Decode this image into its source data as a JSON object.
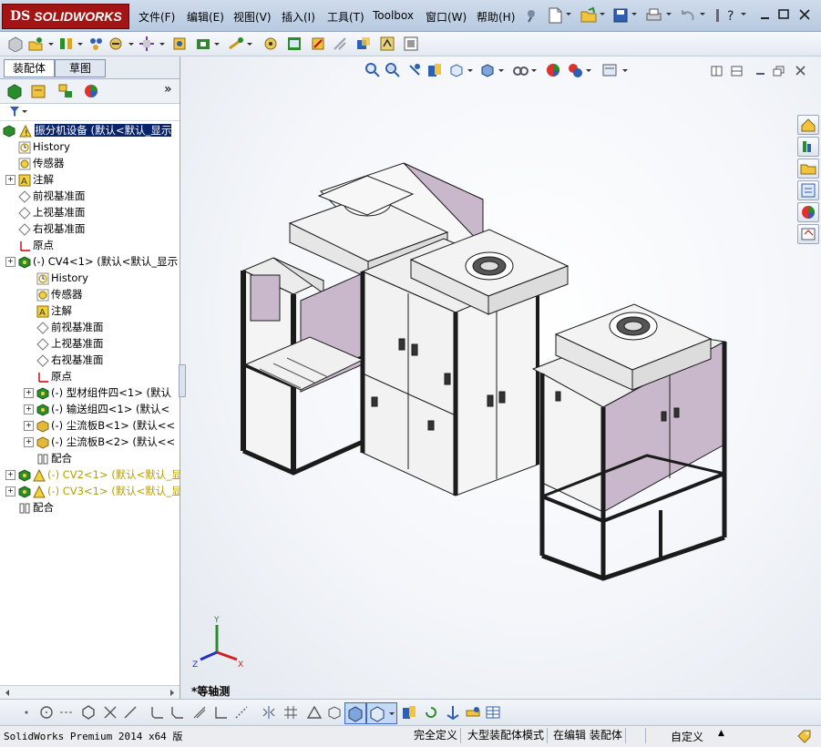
{
  "app": {
    "brand_ds": "DS",
    "brand_name": "SOLIDWORKS"
  },
  "menu": [
    {
      "label": "文件(F)"
    },
    {
      "label": "编辑(E)"
    },
    {
      "label": "视图(V)"
    },
    {
      "label": "插入(I)"
    },
    {
      "label": "工具(T)"
    },
    {
      "label": "Toolbox"
    },
    {
      "label": "窗口(W)"
    },
    {
      "label": "帮助(H)"
    }
  ],
  "panel": {
    "tabs": [
      "装配体",
      "草图"
    ],
    "more": "»",
    "filter_icon": "funnel-icon"
  },
  "tree": {
    "root": "振分机设备 (默认<默认_显示",
    "items": [
      {
        "label": "History",
        "icon": "history-icon"
      },
      {
        "label": "传感器",
        "icon": "sensor-icon"
      },
      {
        "label": "注解",
        "icon": "annotation-icon"
      },
      {
        "label": "前视基准面",
        "icon": "plane-icon"
      },
      {
        "label": "上视基准面",
        "icon": "plane-icon"
      },
      {
        "label": "右视基准面",
        "icon": "plane-icon"
      },
      {
        "label": "原点",
        "icon": "origin-icon"
      },
      {
        "label": "(-) CV4<1> (默认<默认_显示",
        "icon": "assembly-icon"
      },
      {
        "label": "History",
        "icon": "history-icon"
      },
      {
        "label": "传感器",
        "icon": "sensor-icon"
      },
      {
        "label": "注解",
        "icon": "annotation-icon"
      },
      {
        "label": "前视基准面",
        "icon": "plane-icon"
      },
      {
        "label": "上视基准面",
        "icon": "plane-icon"
      },
      {
        "label": "右视基准面",
        "icon": "plane-icon"
      },
      {
        "label": "原点",
        "icon": "origin-icon"
      },
      {
        "label": "(-) 型材组件四<1> (默认",
        "icon": "assembly-icon"
      },
      {
        "label": "(-) 输送组四<1> (默认<",
        "icon": "assembly-icon"
      },
      {
        "label": "(-) 尘流板B<1> (默认<<",
        "icon": "part-icon"
      },
      {
        "label": "(-) 尘流板B<2> (默认<<",
        "icon": "part-icon"
      },
      {
        "label": "配合",
        "icon": "mate-icon"
      },
      {
        "label": "(-) CV2<1> (默认<默认_显",
        "icon": "assembly-icon"
      },
      {
        "label": "(-) CV3<1> (默认<默认_显",
        "icon": "assembly-icon"
      },
      {
        "label": "配合",
        "icon": "mate-icon"
      }
    ]
  },
  "viewport": {
    "view_name": "*等轴测",
    "triad": {
      "x": "X",
      "y": "Y",
      "z": "Z"
    }
  },
  "status": {
    "product": "SolidWorks Premium 2014 x64 版",
    "fully_defined": "完全定义",
    "large_assembly": "大型装配体模式",
    "editing": "在编辑 装配体",
    "custom": "自定义",
    "custom_caret": "▲"
  },
  "colors": {
    "brand": "#a31515",
    "selection": "#0a246a",
    "panel_fill": "#c9b8cc",
    "frame": "#1b1b1b"
  }
}
